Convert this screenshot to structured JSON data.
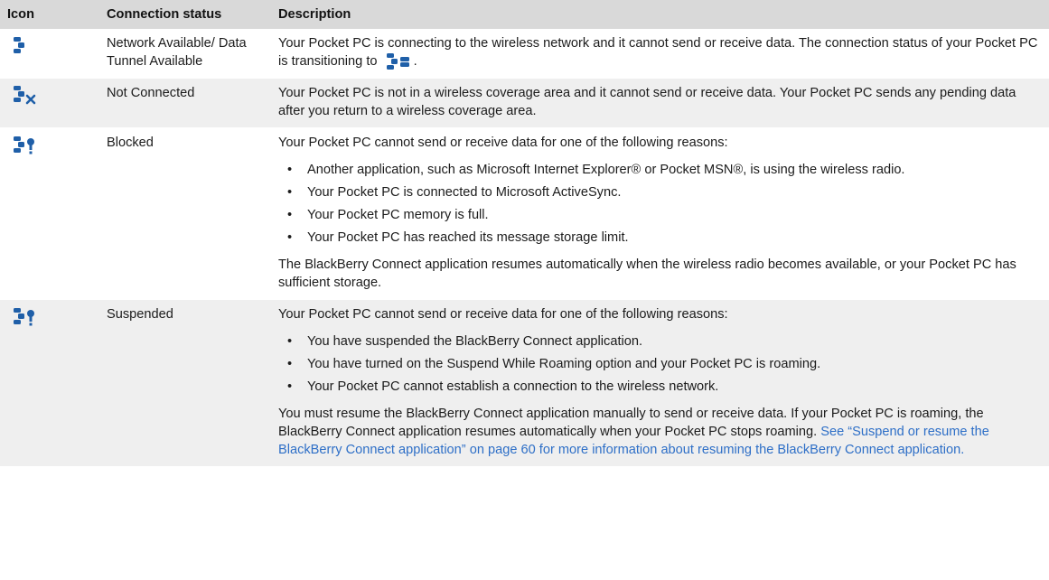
{
  "header": {
    "icon": "Icon",
    "status": "Connection status",
    "description": "Description"
  },
  "colors": {
    "header_bg": "#d9d9d9",
    "stripe_bg": "#efefef",
    "icon_blue": "#1f5fa8",
    "link_blue": "#2e6fc7"
  },
  "rows": [
    {
      "icon_name": "network-available-icon",
      "status": "Network Available/ Data Tunnel Available",
      "desc_before_icon": "Your Pocket PC is connecting to the wireless network and it cannot send or receive data. The connection status of your Pocket PC is transitioning to ",
      "inline_icon_name": "connected-icon",
      "desc_after_icon": "."
    },
    {
      "icon_name": "not-connected-icon",
      "status": "Not Connected",
      "description": "Your Pocket PC is not in a wireless coverage area and it cannot send or receive data. Your Pocket PC sends any pending data after you return to a wireless coverage area."
    },
    {
      "icon_name": "blocked-icon",
      "status": "Blocked",
      "intro": "Your Pocket PC cannot send or receive data for one of the following reasons:",
      "bullets": [
        "Another application, such as Microsoft Internet Explorer® or Pocket MSN®, is using the wireless radio.",
        "Your Pocket PC is connected to Microsoft ActiveSync.",
        "Your Pocket PC memory is full.",
        "Your Pocket PC has reached its message storage limit."
      ],
      "outro": "The BlackBerry Connect application resumes automatically when the wireless radio becomes available, or your Pocket PC has sufficient storage."
    },
    {
      "icon_name": "suspended-icon",
      "status": "Suspended",
      "intro": "Your Pocket PC cannot send or receive data for one of the following reasons:",
      "bullets": [
        "You have suspended the BlackBerry Connect application.",
        "You have turned on the Suspend While Roaming option and your Pocket PC is roaming.",
        "Your Pocket PC cannot establish a connection to the wireless network."
      ],
      "outro": "You must resume the BlackBerry Connect application manually to send or receive data. If your Pocket PC is roaming, the BlackBerry Connect application resumes automatically when your Pocket PC stops roaming. ",
      "link_text": "See “Suspend or resume the BlackBerry Connect application” on page 60 for more information about resuming the BlackBerry Connect application."
    }
  ]
}
